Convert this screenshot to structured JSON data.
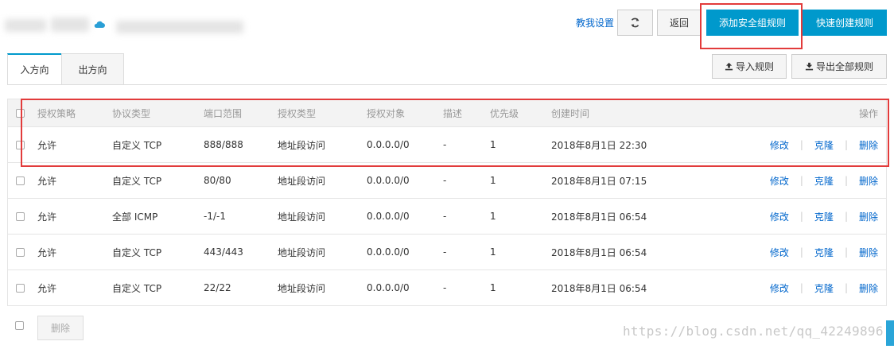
{
  "header": {
    "guide_link": "教我设置",
    "back_label": "返回",
    "add_rule_label": "添加安全组规则",
    "quick_create_label": "快速创建规则"
  },
  "tabs": [
    {
      "label": "入方向"
    },
    {
      "label": "出方向"
    }
  ],
  "toolbar": {
    "import_label": "导入规则",
    "export_label": "导出全部规则"
  },
  "table": {
    "columns": [
      "授权策略",
      "协议类型",
      "端口范围",
      "授权类型",
      "授权对象",
      "描述",
      "优先级",
      "创建时间",
      "操作"
    ],
    "rows": [
      {
        "policy": "允许",
        "protocol": "自定义 TCP",
        "port": "888/888",
        "auth_type": "地址段访问",
        "object": "0.0.0.0/0",
        "desc": "-",
        "priority": "1",
        "time": "2018年8月1日 22:30"
      },
      {
        "policy": "允许",
        "protocol": "自定义 TCP",
        "port": "80/80",
        "auth_type": "地址段访问",
        "object": "0.0.0.0/0",
        "desc": "-",
        "priority": "1",
        "time": "2018年8月1日 07:15"
      },
      {
        "policy": "允许",
        "protocol": "全部 ICMP",
        "port": "-1/-1",
        "auth_type": "地址段访问",
        "object": "0.0.0.0/0",
        "desc": "-",
        "priority": "1",
        "time": "2018年8月1日 06:54"
      },
      {
        "policy": "允许",
        "protocol": "自定义 TCP",
        "port": "443/443",
        "auth_type": "地址段访问",
        "object": "0.0.0.0/0",
        "desc": "-",
        "priority": "1",
        "time": "2018年8月1日 06:54"
      },
      {
        "policy": "允许",
        "protocol": "自定义 TCP",
        "port": "22/22",
        "auth_type": "地址段访问",
        "object": "0.0.0.0/0",
        "desc": "-",
        "priority": "1",
        "time": "2018年8月1日 06:54"
      }
    ],
    "ops": {
      "edit": "修改",
      "clone": "克隆",
      "delete": "删除"
    }
  },
  "footer": {
    "delete_label": "删除",
    "watermark": "https://blog.csdn.net/qq_42249896"
  },
  "colors": {
    "primary": "#0099cc",
    "link": "#0066cc",
    "annotation": "#e23b3b"
  },
  "icons": [
    "cloud-icon",
    "refresh-icon",
    "upload-icon",
    "download-icon"
  ]
}
